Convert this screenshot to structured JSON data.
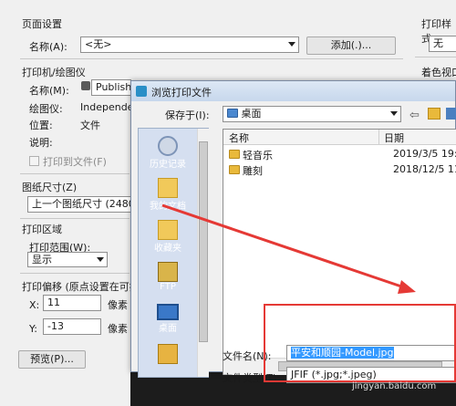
{
  "page_setup": {
    "title": "页面设置",
    "name_label": "名称(A):",
    "name_value": "<无>",
    "add_button": "添加(.)..."
  },
  "plot_style": {
    "title": "打印样式",
    "value": "无"
  },
  "printer": {
    "title": "打印机/绘图仪",
    "name_label": "名称(M):",
    "name_value": "Publish",
    "plotter_label": "绘图仪:",
    "plotter_value": "Independer",
    "location_label": "位置:",
    "location_value": "文件",
    "description_label": "说明:",
    "print_to_file": "打印到文件(F)",
    "right_header": "日期",
    "shaded_title": "着色视口"
  },
  "paper": {
    "title": "图纸尺寸(Z)",
    "value": "上一个图纸尺寸  (2480"
  },
  "area": {
    "title": "打印区域",
    "range_label": "打印范围(W):",
    "range_value": "显示"
  },
  "offset": {
    "title": "打印偏移 (原点设置在可打",
    "x_label": "X:",
    "x_value": "11",
    "x_unit": "像素",
    "y_label": "Y:",
    "y_value": "-13",
    "y_unit": "像素"
  },
  "preview_button": "预览(P)...",
  "browse": {
    "title": "浏览打印文件",
    "save_in_label": "保存于(I):",
    "save_in_value": "桌面",
    "sidebar": [
      "历史记录",
      "我的文档",
      "收藏夹",
      "FTP",
      "桌面",
      ""
    ],
    "columns": [
      "名称",
      "日期"
    ],
    "files": [
      {
        "name": "轻音乐",
        "date": "2019/3/5 19:52"
      },
      {
        "name": "雕刻",
        "date": "2018/12/5 11:5"
      }
    ],
    "filename_label": "文件名(N):",
    "filename_value": "平安和顺园-Model.jpg",
    "filetype_label": "文件类型(T):",
    "filetype_value": "JFIF (*.jpg;*.jpeg)"
  },
  "watermark": "jingyan.baidu.com",
  "colors": {
    "annotation": "#e53935",
    "selection": "#3399ff"
  }
}
